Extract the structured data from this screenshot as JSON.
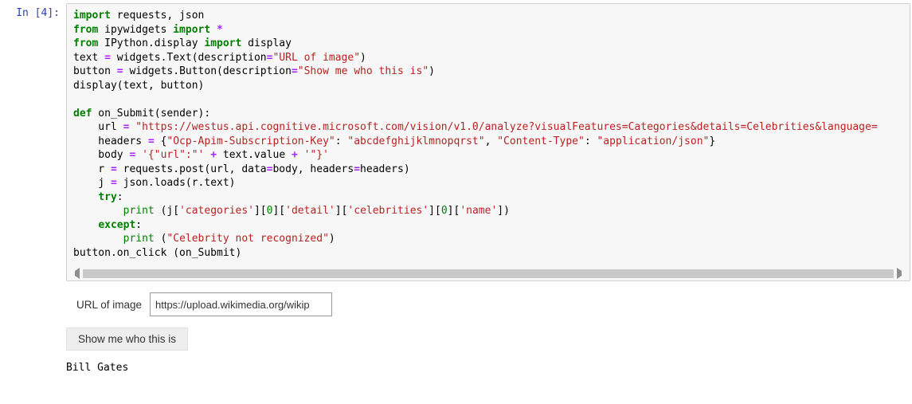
{
  "prompt": {
    "prefix": "In [",
    "number": "4",
    "suffix": "]:"
  },
  "code": {
    "line1_import": "import",
    "line1_mods": " requests, json",
    "line2_from": "from",
    "line2_mod": " ipywidgets ",
    "line2_import": "import",
    "line2_star": " *",
    "line3_from": "from",
    "line3_mod": " IPython.display ",
    "line3_import": "import",
    "line3_rest": " display",
    "line4_a": "text ",
    "line4_op": "=",
    "line4_b": " widgets.Text(description",
    "line4_op2": "=",
    "line4_str": "\"URL of image\"",
    "line4_c": ")",
    "line5_a": "button ",
    "line5_op": "=",
    "line5_b": " widgets.Button(description",
    "line5_op2": "=",
    "line5_str": "\"Show me who this is\"",
    "line5_c": ")",
    "line6": "display(text, button)",
    "line8_def": "def",
    "line8_name": " on_Submit",
    "line8_rest": "(sender):",
    "line9_a": "    url ",
    "line9_op": "=",
    "line9_sp": " ",
    "line9_str": "\"https://westus.api.cognitive.microsoft.com/vision/v1.0/analyze?visualFeatures=Categories&details=Celebrities&language=",
    "line10_a": "    headers ",
    "line10_op": "=",
    "line10_b": " {",
    "line10_s1": "\"Ocp-Apim-Subscription-Key\"",
    "line10_c": ": ",
    "line10_s2": "\"abcdefghijklmnopqrst\"",
    "line10_d": ", ",
    "line10_s3": "\"Content-Type\"",
    "line10_e": ": ",
    "line10_s4": "\"application/json\"",
    "line10_f": "}",
    "line11_a": "    body ",
    "line11_op": "=",
    "line11_sp": " ",
    "line11_s1": "'{\"url\":\"'",
    "line11_plus1": " + ",
    "line11_mid": "text.value",
    "line11_plus2": " + ",
    "line11_s2": "'\"}'",
    "line12_a": "    r ",
    "line12_op": "=",
    "line12_b": " requests.post(url, data",
    "line12_op2": "=",
    "line12_c": "body, headers",
    "line12_op3": "=",
    "line12_d": "headers)",
    "line13_a": "    j ",
    "line13_op": "=",
    "line13_b": " json.loads(r.text)",
    "line14_try": "try",
    "line14_colon": ":",
    "line15_pad": "        ",
    "line15_print": "print",
    "line15_a": " (j[",
    "line15_s1": "'categories'",
    "line15_b": "][",
    "line15_n1": "0",
    "line15_c": "][",
    "line15_s2": "'detail'",
    "line15_d": "][",
    "line15_s3": "'celebrities'",
    "line15_e": "][",
    "line15_n2": "0",
    "line15_f": "][",
    "line15_s4": "'name'",
    "line15_g": "])",
    "line16_except": "except",
    "line16_colon": ":",
    "line17_pad": "        ",
    "line17_print": "print",
    "line17_a": " (",
    "line17_s1": "\"Celebrity not recognized\"",
    "line17_b": ")",
    "line18": "button.on_click (on_Submit)"
  },
  "widgets": {
    "text_label": "URL of image",
    "text_value": "https://upload.wikimedia.org/wikip",
    "button_label": "Show me who this is"
  },
  "output_text": "Bill Gates"
}
